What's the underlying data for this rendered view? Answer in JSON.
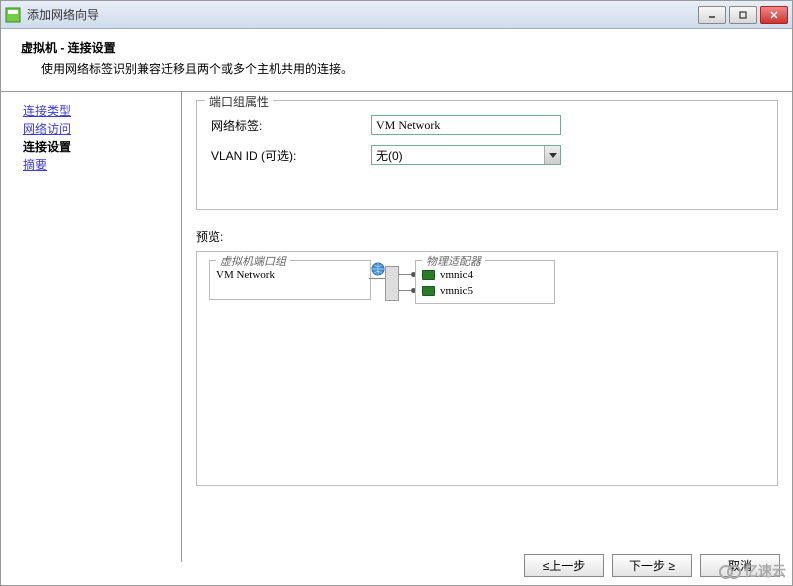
{
  "window": {
    "title": "添加网络向导"
  },
  "header": {
    "title": "虚拟机 - 连接设置",
    "description": "使用网络标签识别兼容迁移且两个或多个主机共用的连接。"
  },
  "sidebar": {
    "items": [
      {
        "label": "连接类型",
        "current": false
      },
      {
        "label": "网络访问",
        "current": false
      },
      {
        "label": "连接设置",
        "current": true
      },
      {
        "label": "摘要",
        "current": false
      }
    ]
  },
  "portGroup": {
    "legend": "端口组属性",
    "networkLabelText": "网络标签:",
    "networkLabelValue": "VM Network",
    "vlanLabelText": "VLAN ID (可选):",
    "vlanValue": "无(0)"
  },
  "preview": {
    "label": "预览:",
    "vmGroupTitle": "虚拟机端口组",
    "vmGroupValue": "VM Network",
    "paGroupTitle": "物理适配器",
    "nics": [
      {
        "name": "vmnic4"
      },
      {
        "name": "vmnic5"
      }
    ]
  },
  "footer": {
    "back": "≤上一步",
    "next": "下一步 ≥",
    "cancel": "取消"
  },
  "watermark": "亿速云"
}
